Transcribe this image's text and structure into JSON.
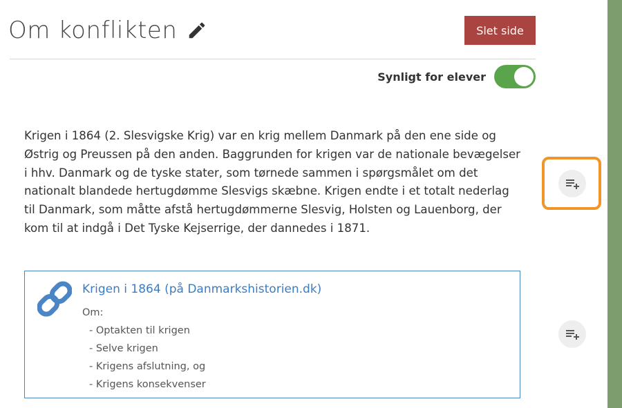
{
  "page": {
    "title": "Om konflikten",
    "delete_label": "Slet side",
    "visibility_label": "Synligt for elever",
    "visible": true
  },
  "content": {
    "text": "Krigen i 1864 (2. Slesvigske Krig) var en krig mellem Danmark på den ene side og Østrig og Preussen på den anden. Baggrunden for krigen var de nationale bevægelser i hhv. Danmark og de tyske stater, som tørnede sammen i spørgsmålet om det nationalt blandede hertugdømme Slesvigs skæbne. Krigen endte i et totalt nederlag til Danmark, som måtte afstå hertugdømmerne Slesvig, Holsten og Lauenborg, der kom til at indgå i Det Tyske Kejserrige, der dannedes i 1871."
  },
  "link_card": {
    "title": "Krigen i 1864 (på Danmarkshistorien.dk)",
    "intro": "Om:",
    "items": [
      "- Optakten til krigen",
      "- Selve krigen",
      "- Krigens afslutning, og",
      "- Krigens konsekvenser"
    ]
  },
  "colors": {
    "delete_button": "#a94440",
    "toggle_on": "#5aa54b",
    "link": "#3b7dc2",
    "highlight": "#f0952a",
    "side_bar": "#7d9d6f"
  },
  "icons": {
    "edit": "pencil-icon",
    "link": "chain-link-icon",
    "add_block": "playlist-add-icon"
  }
}
